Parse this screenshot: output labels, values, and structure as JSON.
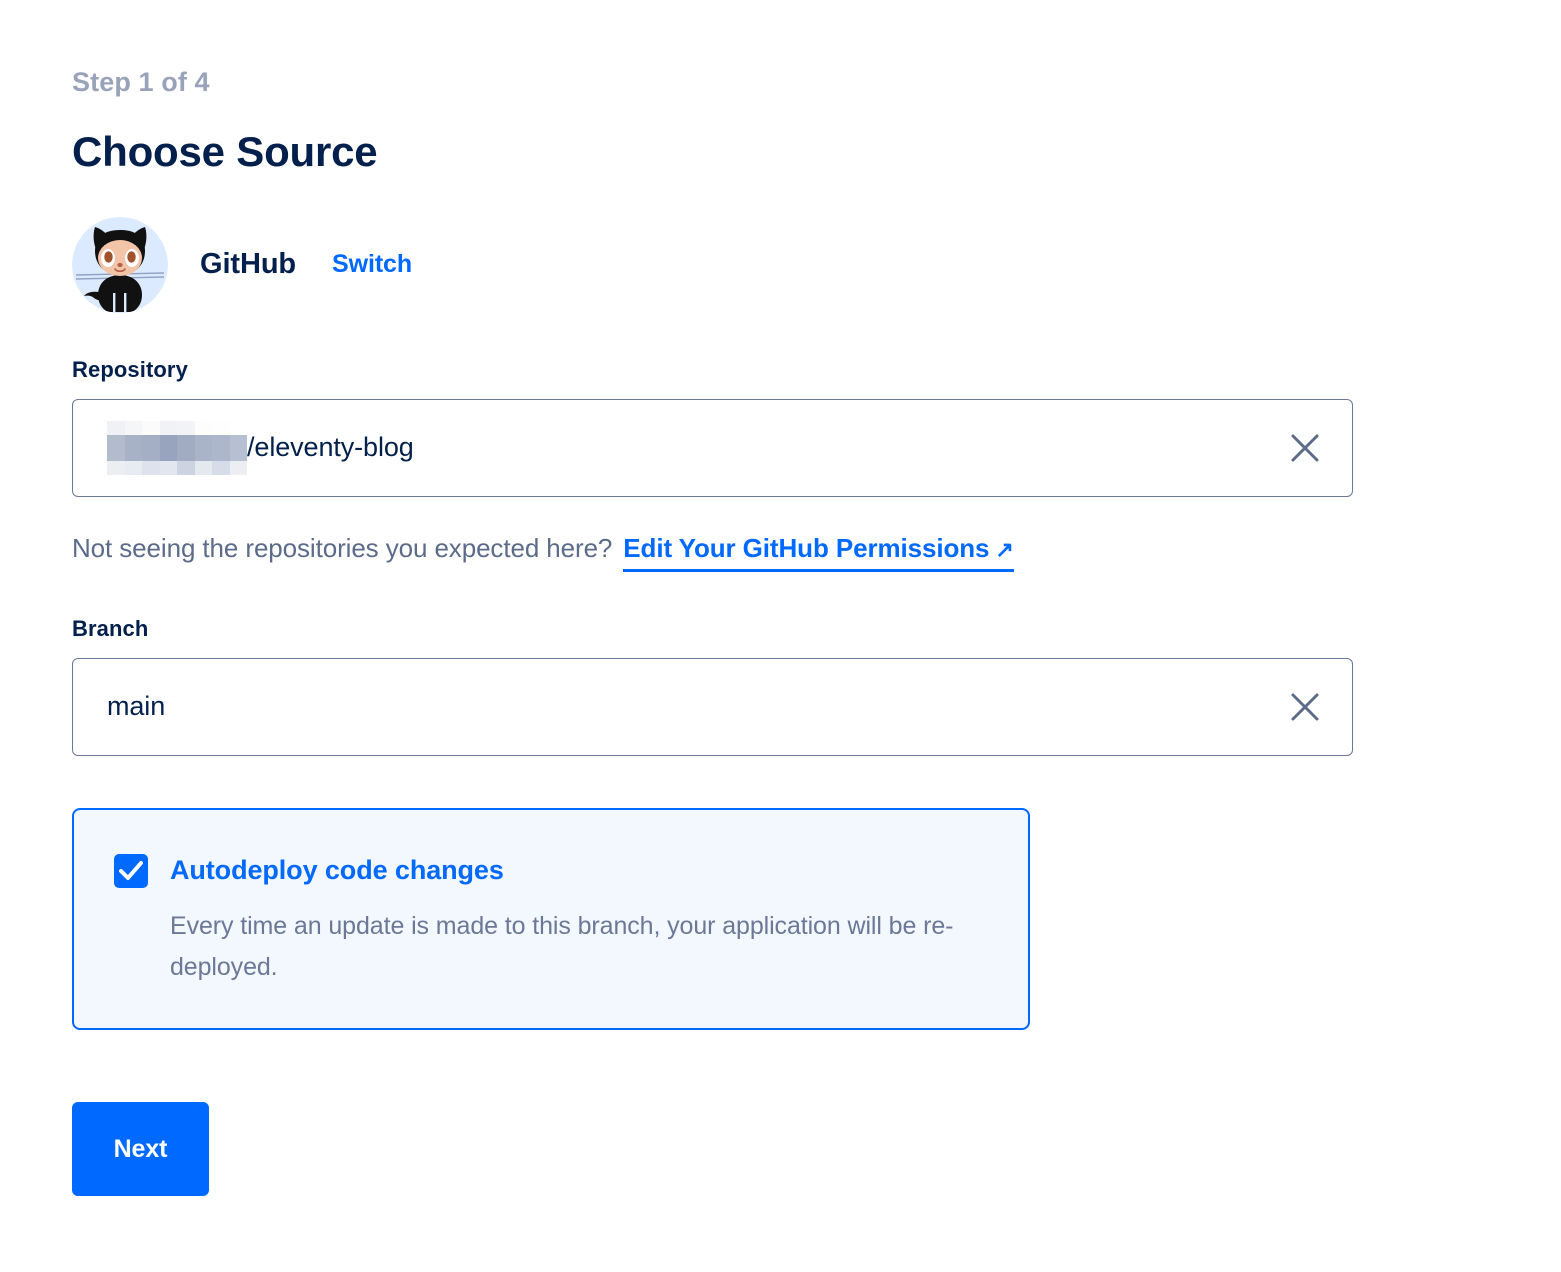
{
  "wizard": {
    "step_label": "Step 1 of 4",
    "title": "Choose Source"
  },
  "provider": {
    "name": "GitHub",
    "switch_label": "Switch",
    "logo_icon": "github-octocat-icon",
    "logo_bg_color": "#dbeafe"
  },
  "repository": {
    "label": "Repository",
    "value_redacted_prefix": "",
    "value_suffix": "/eleventy-blog",
    "clear_icon": "close-icon"
  },
  "helper": {
    "text": "Not seeing the repositories you expected here?",
    "link_label": "Edit Your GitHub Permissions",
    "link_arrow": "↗"
  },
  "branch": {
    "label": "Branch",
    "value": "main",
    "clear_icon": "close-icon"
  },
  "autodeploy": {
    "checked": true,
    "title": "Autodeploy code changes",
    "description": "Every time an update is made to this branch, your application will be re-deployed."
  },
  "actions": {
    "next_label": "Next"
  },
  "colors": {
    "accent_blue": "#0069ff",
    "title_navy": "#03204c",
    "muted_gray": "#98a2b9",
    "body_gray": "#6b7897",
    "panel_bg": "#f3f8ff",
    "input_border": "#6b7897"
  }
}
